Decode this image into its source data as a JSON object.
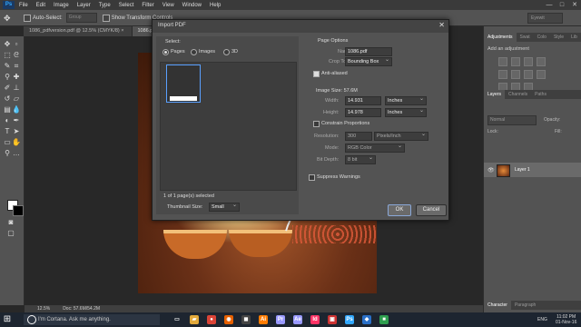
{
  "app": {
    "logo": "Ps",
    "menu": [
      "File",
      "Edit",
      "Image",
      "Layer",
      "Type",
      "Select",
      "Filter",
      "View",
      "Window",
      "Help"
    ],
    "window_controls": [
      "—",
      "□",
      "✕"
    ]
  },
  "options_bar": {
    "auto_select_label": "Auto-Select:",
    "auto_select_value": "Group",
    "transform_label": "Show Transform Controls",
    "workspace": "Eyewit"
  },
  "doc_tabs": [
    {
      "label": "1086_pdfversion.pdf @ 12.5% (CMYK/8) ×",
      "active": false
    },
    {
      "label": "1086.pdf",
      "active": true
    }
  ],
  "status_bar": {
    "zoom": "12.5%",
    "doc_info": "Doc: 57.6M/54.2M"
  },
  "right_panel": {
    "top_tabs": [
      "Adjustments",
      "Swat",
      "Colo",
      "Style",
      "Lib"
    ],
    "adj_title": "Add an adjustment",
    "layer_tabs": [
      "Layers",
      "Channels",
      "Paths"
    ],
    "kind": "Normal",
    "opacity_label": "Opacity:",
    "lock_label": "Lock:",
    "fill_label": "Fill:",
    "layer_name": "Layer 1",
    "bottom_tabs": [
      "Character",
      "Paragraph"
    ]
  },
  "dialog": {
    "title": "Import PDF",
    "close": "✕",
    "select_label": "Select:",
    "radios": [
      {
        "label": "Pages",
        "selected": true
      },
      {
        "label": "Images",
        "selected": false
      },
      {
        "label": "3D",
        "selected": false
      }
    ],
    "selection_count": "1 of 1 page(s) selected",
    "thumbnail_size_label": "Thumbnail Size:",
    "thumbnail_size": "Small",
    "page_options_title": "Page Options",
    "name_label": "Name:",
    "name_value": "1086.pdf",
    "crop_label": "Crop To:",
    "crop_value": "Bounding Box",
    "anti_aliased_label": "Anti-aliased",
    "image_size_label": "Image Size: 57.6M",
    "width_label": "Width:",
    "width_value": "14.931",
    "width_unit": "Inches",
    "height_label": "Height:",
    "height_value": "14.978",
    "height_unit": "Inches",
    "constrain_label": "Constrain Proportions",
    "resolution_label": "Resolution:",
    "resolution_value": "300",
    "resolution_unit": "Pixels/Inch",
    "mode_label": "Mode:",
    "mode_value": "RGB Color",
    "bitdepth_label": "Bit Depth:",
    "bitdepth_value": "8 bit",
    "suppress_label": "Suppress Warnings",
    "ok": "OK",
    "cancel": "Cancel"
  },
  "taskbar": {
    "cortana": "I'm Cortana. Ask me anything.",
    "language": "ENG",
    "time": "11:02 PM",
    "date": "01-Nov-16",
    "apps": [
      {
        "name": "task-view",
        "glyph": "▭",
        "color": "#1d2530"
      },
      {
        "name": "file-explorer",
        "glyph": "▰",
        "color": "#e2a93b"
      },
      {
        "name": "chrome",
        "glyph": "●",
        "color": "#db4437"
      },
      {
        "name": "firefox",
        "glyph": "◉",
        "color": "#e66000"
      },
      {
        "name": "app-dark",
        "glyph": "◼",
        "color": "#444"
      },
      {
        "name": "illustrator",
        "glyph": "Ai",
        "color": "#ff7c00"
      },
      {
        "name": "premiere",
        "glyph": "Pr",
        "color": "#9999ff"
      },
      {
        "name": "after-effects",
        "glyph": "Ae",
        "color": "#9999ff"
      },
      {
        "name": "indesign",
        "glyph": "Id",
        "color": "#ff3366"
      },
      {
        "name": "app-red",
        "glyph": "▣",
        "color": "#cc3333"
      },
      {
        "name": "photoshop",
        "glyph": "Ps",
        "color": "#31a8ff"
      },
      {
        "name": "app-blue",
        "glyph": "◆",
        "color": "#2a70c8"
      },
      {
        "name": "app-green",
        "glyph": "■",
        "color": "#2e9e4e"
      }
    ]
  }
}
